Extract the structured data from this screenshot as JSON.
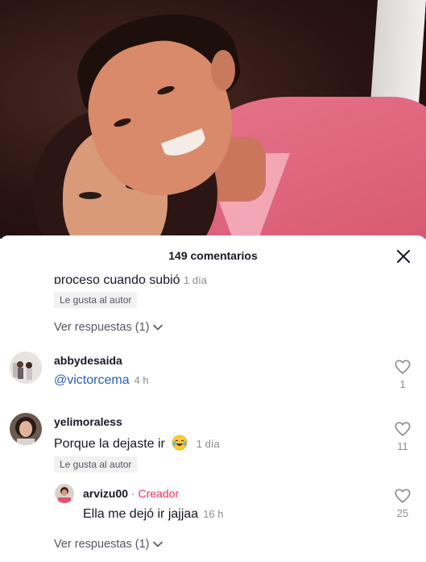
{
  "header": {
    "comment_count": "149 comentarios",
    "close_icon": "close-icon"
  },
  "truncated_comment": {
    "text": "proceso cuando subió",
    "time": "1 día",
    "liked_badge": "Le gusta al autor",
    "view_replies": "Ver respuestas (1)"
  },
  "comments": [
    {
      "username": "abbydesaida",
      "mention": "@victorcema",
      "text": "",
      "time": "4 h",
      "likes": "1"
    },
    {
      "username": "yelimoraless",
      "text": "Porque la dejaste ir",
      "emoji": "laughing-crying-emoji",
      "time": "1 día",
      "likes": "11",
      "liked_badge": "Le gusta al autor"
    }
  ],
  "reply": {
    "username": "arvizu00",
    "separator": "·",
    "creator_label": "Creador",
    "text": "Ella me dejó ir jajjaa",
    "time": "16 h",
    "likes": "25"
  },
  "footer": {
    "view_replies": "Ver respuestas (1)"
  },
  "colors": {
    "accent": "#fe2c55",
    "mention": "#2b5db9",
    "muted": "#8a8b91"
  }
}
